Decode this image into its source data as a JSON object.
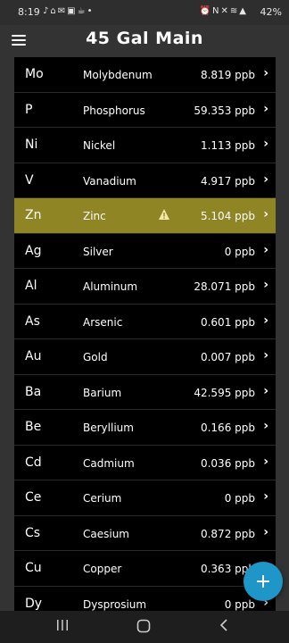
{
  "status_bar": {
    "time": "8:19",
    "battery": "42%",
    "left_icons": [
      "tiktok-icon",
      "home-icon",
      "gmail-icon",
      "photo-icon",
      "teapot-icon",
      "dot-icon"
    ],
    "right_icons": [
      "alarm-icon",
      "nfc-icon",
      "mute-icon",
      "wifi-icon",
      "signal-icon"
    ]
  },
  "appbar": {
    "title": "45 Gal Main"
  },
  "elements": [
    {
      "symbol": "Mo",
      "name": "Molybdenum",
      "value": "8.819 ppb",
      "alert": false
    },
    {
      "symbol": "P",
      "name": "Phosphorus",
      "value": "59.353 ppb",
      "alert": false
    },
    {
      "symbol": "Ni",
      "name": "Nickel",
      "value": "1.113 ppb",
      "alert": false
    },
    {
      "symbol": "V",
      "name": "Vanadium",
      "value": "4.917 ppb",
      "alert": false
    },
    {
      "symbol": "Zn",
      "name": "Zinc",
      "value": "5.104 ppb",
      "alert": true
    },
    {
      "symbol": "Ag",
      "name": "Silver",
      "value": "0 ppb",
      "alert": false
    },
    {
      "symbol": "Al",
      "name": "Aluminum",
      "value": "28.071 ppb",
      "alert": false
    },
    {
      "symbol": "As",
      "name": "Arsenic",
      "value": "0.601 ppb",
      "alert": false
    },
    {
      "symbol": "Au",
      "name": "Gold",
      "value": "0.007 ppb",
      "alert": false
    },
    {
      "symbol": "Ba",
      "name": "Barium",
      "value": "42.595 ppb",
      "alert": false
    },
    {
      "symbol": "Be",
      "name": "Beryllium",
      "value": "0.166 ppb",
      "alert": false
    },
    {
      "symbol": "Cd",
      "name": "Cadmium",
      "value": "0.036 ppb",
      "alert": false
    },
    {
      "symbol": "Ce",
      "name": "Cerium",
      "value": "0 ppb",
      "alert": false
    },
    {
      "symbol": "Cs",
      "name": "Caesium",
      "value": "0.872 ppb",
      "alert": false
    },
    {
      "symbol": "Cu",
      "name": "Copper",
      "value": "0.363 ppb",
      "alert": false
    },
    {
      "symbol": "Dy",
      "name": "Dysprosium",
      "value": "0 ppb",
      "alert": false
    }
  ],
  "colors": {
    "alert_row": "#8f8524",
    "fab": "#1e96c8",
    "list_background": "#000000",
    "page_background": "#333333"
  },
  "fab": {
    "icon": "plus-icon"
  },
  "navbar": {
    "icons": [
      "recent-apps-icon",
      "home-circle-icon",
      "back-icon"
    ]
  }
}
